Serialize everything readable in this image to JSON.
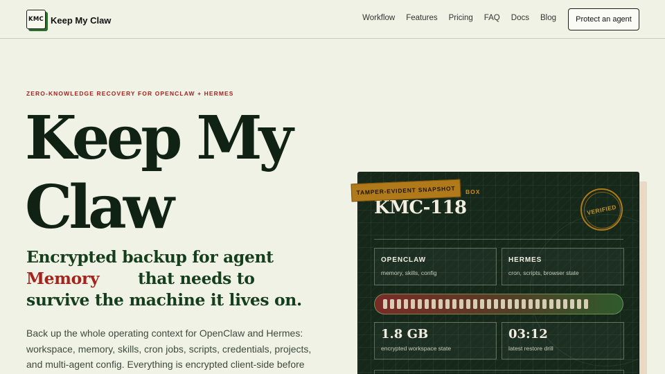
{
  "header": {
    "logo_mark": "KMC",
    "brand": "Keep My Claw",
    "nav": [
      "Workflow",
      "Features",
      "Pricing",
      "FAQ",
      "Docs",
      "Blog"
    ],
    "cta": "Protect an agent"
  },
  "hero": {
    "eyebrow": "ZERO-KNOWLEDGE RECOVERY FOR OPENCLAW + HERMES",
    "title_line1": "Keep My",
    "title_line2": "Claw",
    "sub_line1": "Encrypted backup for agent",
    "sub_red": "Memory",
    "sub_line2_rest": "that needs to",
    "sub_line3": "survive the machine it lives on.",
    "body": "Back up the whole operating context for OpenClaw and Hermes: workspace, memory, skills, cron jobs, scripts, credentials, projects, and multi-agent config. Everything is encrypted client-side before"
  },
  "card": {
    "stamp": "TAMPER-EVIDENT SNAPSHOT",
    "stamp_rest": "BOX",
    "id": "KMC-118",
    "verified": "VERIFIED",
    "tiles": [
      {
        "title": "OPENCLAW",
        "sub": "memory, skills, config"
      },
      {
        "title": "HERMES",
        "sub": "cron, scripts, browser state"
      }
    ],
    "stats": [
      {
        "value": "1.8 GB",
        "label": "encrypted workspace state"
      },
      {
        "value": "03:12",
        "label": "latest restore drill"
      }
    ],
    "progress_segments": 30
  }
}
